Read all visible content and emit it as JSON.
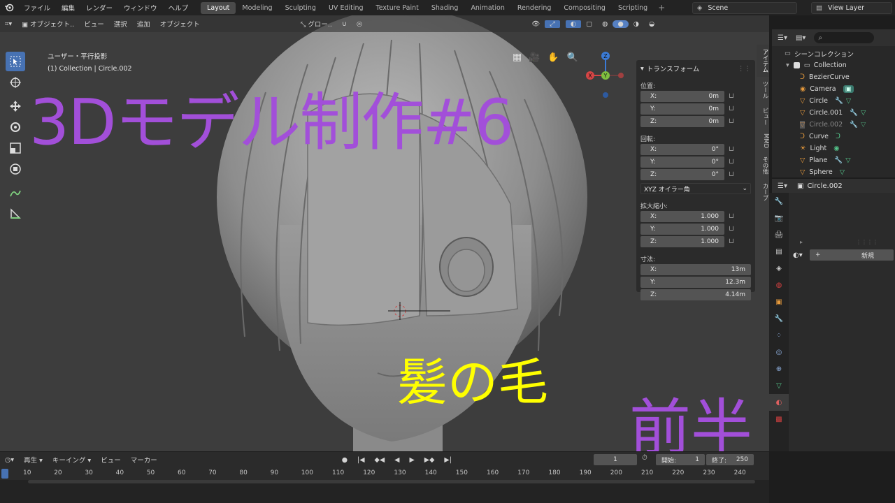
{
  "topbar": {
    "menu": [
      "ファイル",
      "編集",
      "レンダー",
      "ウィンドウ",
      "ヘルプ"
    ],
    "workspaces": [
      "Layout",
      "Modeling",
      "Sculpting",
      "UV Editing",
      "Texture Paint",
      "Shading",
      "Animation",
      "Rendering",
      "Compositing",
      "Scripting"
    ],
    "active_workspace": "Layout",
    "scene": "Scene",
    "view_layer": "View Layer"
  },
  "viewport": {
    "mode": "オブジェクト..",
    "menu": [
      "ビュー",
      "選択",
      "追加",
      "オブジェクト"
    ],
    "transform_orientation": "グロー..",
    "info_line1": "ユーザー・平行投影",
    "info_line2": "(1) Collection | Circle.002",
    "gizmo": {
      "x": "X",
      "y": "Y",
      "z": "Z"
    }
  },
  "overlay": {
    "title": "3Dモデル制作#6",
    "subtitle": "髪の毛",
    "tag": "前半",
    "title_color": "#a24fd9",
    "subtitle_color": "#ffff00"
  },
  "npanel": {
    "header": "トランスフォーム",
    "location_label": "位置:",
    "location": [
      {
        "axis": "X:",
        "value": "0m"
      },
      {
        "axis": "Y:",
        "value": "0m"
      },
      {
        "axis": "Z:",
        "value": "0m"
      }
    ],
    "rotation_label": "回転:",
    "rotation": [
      {
        "axis": "X:",
        "value": "0°"
      },
      {
        "axis": "Y:",
        "value": "0°"
      },
      {
        "axis": "Z:",
        "value": "0°"
      }
    ],
    "rotation_mode": "XYZ オイラー角",
    "scale_label": "拡大縮小:",
    "scale": [
      {
        "axis": "X:",
        "value": "1.000"
      },
      {
        "axis": "Y:",
        "value": "1.000"
      },
      {
        "axis": "Z:",
        "value": "1.000"
      }
    ],
    "dimensions_label": "寸法:",
    "dimensions": [
      {
        "axis": "X:",
        "value": "13m"
      },
      {
        "axis": "Y:",
        "value": "12.3m"
      },
      {
        "axis": "Z:",
        "value": "4.14m"
      }
    ],
    "tabs": [
      "アイテム",
      "ツール",
      "ビュー",
      "MMD",
      "その他",
      "カーブ"
    ]
  },
  "outliner": {
    "root": "シーンコレクション",
    "collection": "Collection",
    "items": [
      {
        "name": "BezierCurve",
        "icon": "curve-icon",
        "dim": false
      },
      {
        "name": "Camera",
        "icon": "camera-icon",
        "dim": false
      },
      {
        "name": "Circle",
        "icon": "mesh-icon",
        "dim": false
      },
      {
        "name": "Circle.001",
        "icon": "mesh-icon",
        "dim": false
      },
      {
        "name": "Circle.002",
        "icon": "mesh-icon",
        "dim": true
      },
      {
        "name": "Curve",
        "icon": "curve-icon",
        "dim": false
      },
      {
        "name": "Light",
        "icon": "light-icon",
        "dim": false
      },
      {
        "name": "Plane",
        "icon": "mesh-icon",
        "dim": false
      },
      {
        "name": "Sphere",
        "icon": "mesh-icon",
        "dim": false
      }
    ]
  },
  "properties": {
    "object_name": "Circle.002",
    "new_button": "新規"
  },
  "timeline": {
    "menu": [
      "再生",
      "キーイング",
      "ビュー",
      "マーカー"
    ],
    "current_frame": "1",
    "start_label": "開始:",
    "start": "1",
    "end_label": "終了:",
    "end": "250",
    "ticks": [
      "10",
      "20",
      "30",
      "40",
      "50",
      "60",
      "70",
      "80",
      "90",
      "100",
      "110",
      "120",
      "130",
      "140",
      "150",
      "160",
      "170",
      "180",
      "190",
      "200",
      "210",
      "220",
      "230",
      "240"
    ]
  }
}
